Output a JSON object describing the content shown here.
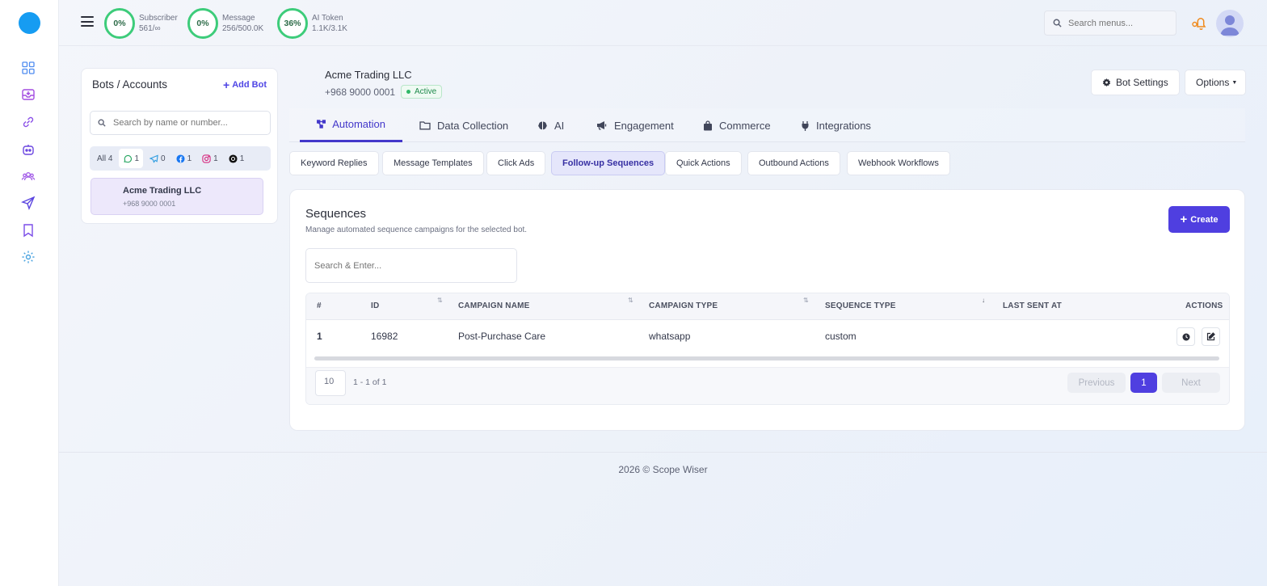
{
  "topbar": {
    "stats": [
      {
        "percent": "0%",
        "label": "Subscriber",
        "value": "561/∞"
      },
      {
        "percent": "0%",
        "label": "Message",
        "value": "256/500.0K"
      },
      {
        "percent": "36%",
        "label": "AI Token",
        "value": "1.1K/3.1K"
      }
    ],
    "search_placeholder": "Search menus..."
  },
  "sidebar": {
    "icons": [
      "dashboard-icon",
      "inbox-icon",
      "links-icon",
      "bot-icon",
      "users-icon",
      "send-icon",
      "bookmark-icon",
      "settings-icon"
    ]
  },
  "bots_panel": {
    "title": "Bots / Accounts",
    "add_label": "Add Bot",
    "search_placeholder": "Search by name or number...",
    "filters": [
      {
        "label": "All",
        "count": "4"
      },
      {
        "icon": "whatsapp-icon",
        "count": "1"
      },
      {
        "icon": "telegram-icon",
        "count": "0"
      },
      {
        "icon": "facebook-icon",
        "count": "1"
      },
      {
        "icon": "instagram-icon",
        "count": "1"
      },
      {
        "icon": "threads-icon",
        "count": "1"
      }
    ],
    "bots": [
      {
        "name": "Acme Trading LLC",
        "phone": "+968 9000 0001"
      }
    ]
  },
  "bot_header": {
    "name": "Acme Trading LLC",
    "phone": "+968 9000 0001",
    "status": "Active",
    "settings_label": "Bot Settings",
    "options_label": "Options"
  },
  "main_tabs": [
    {
      "label": "Automation",
      "icon": "flow-icon"
    },
    {
      "label": "Data Collection",
      "icon": "folder-icon"
    },
    {
      "label": "AI",
      "icon": "brain-icon"
    },
    {
      "label": "Engagement",
      "icon": "megaphone-icon"
    },
    {
      "label": "Commerce",
      "icon": "bag-icon"
    },
    {
      "label": "Integrations",
      "icon": "plug-icon"
    }
  ],
  "sub_tabs": [
    "Keyword Replies",
    "Message Templates",
    "Click Ads",
    "Follow-up Sequences",
    "Quick Actions",
    "Outbound Actions",
    "Webhook Workflows"
  ],
  "sequences": {
    "title": "Sequences",
    "subtitle": "Manage automated sequence campaigns for the selected bot.",
    "create_label": "Create",
    "search_placeholder": "Search & Enter...",
    "columns": [
      "#",
      "ID",
      "CAMPAIGN NAME",
      "CAMPAIGN TYPE",
      "SEQUENCE TYPE",
      "LAST SENT AT",
      "ACTIONS"
    ],
    "rows": [
      {
        "num": "1",
        "id": "16982",
        "campaign_name": "Post-Purchase Care",
        "campaign_type": "whatsapp",
        "sequence_type": "custom",
        "last_sent_at": ""
      }
    ],
    "page_size": "10",
    "range": "1 - 1 of 1",
    "prev_label": "Previous",
    "current_page": "1",
    "next_label": "Next"
  },
  "footer": {
    "copyright": "2026 © Scope Wiser"
  },
  "colors": {
    "accent": "#4f3fe0",
    "ring": "#3dcc7a",
    "logo": "#169cf2",
    "active_badge": "#1f8a4c"
  }
}
